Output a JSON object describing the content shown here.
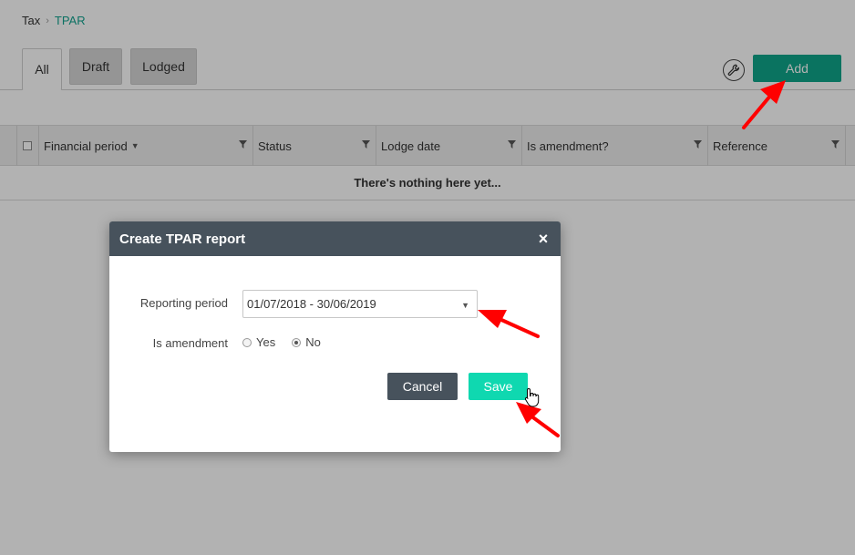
{
  "breadcrumb": {
    "root": "Tax",
    "separator": "›",
    "current": "TPAR"
  },
  "tabs": [
    {
      "label": "All",
      "active": true
    },
    {
      "label": "Draft",
      "active": false
    },
    {
      "label": "Lodged",
      "active": false
    }
  ],
  "toolbar": {
    "settings_icon": "wrench-icon",
    "add_label": "Add"
  },
  "grid": {
    "columns": [
      "Financial period",
      "Status",
      "Lodge date",
      "Is amendment?",
      "Reference"
    ],
    "sort_indicator": "▼",
    "empty_message": "There's nothing here yet..."
  },
  "modal": {
    "title": "Create TPAR report",
    "close_label": "×",
    "reporting_period_label": "Reporting period",
    "reporting_period_value": "01/07/2018 - 30/06/2019",
    "select_caret": "▼",
    "is_amendment_label": "Is amendment",
    "options": [
      {
        "label": "Yes",
        "selected": false
      },
      {
        "label": "No",
        "selected": true
      }
    ],
    "cancel_label": "Cancel",
    "save_label": "Save"
  },
  "colors": {
    "accent": "#0fa58a",
    "save": "#0fd8b0",
    "header": "#47525c",
    "link": "#12a38f",
    "arrow": "#ff0000"
  }
}
